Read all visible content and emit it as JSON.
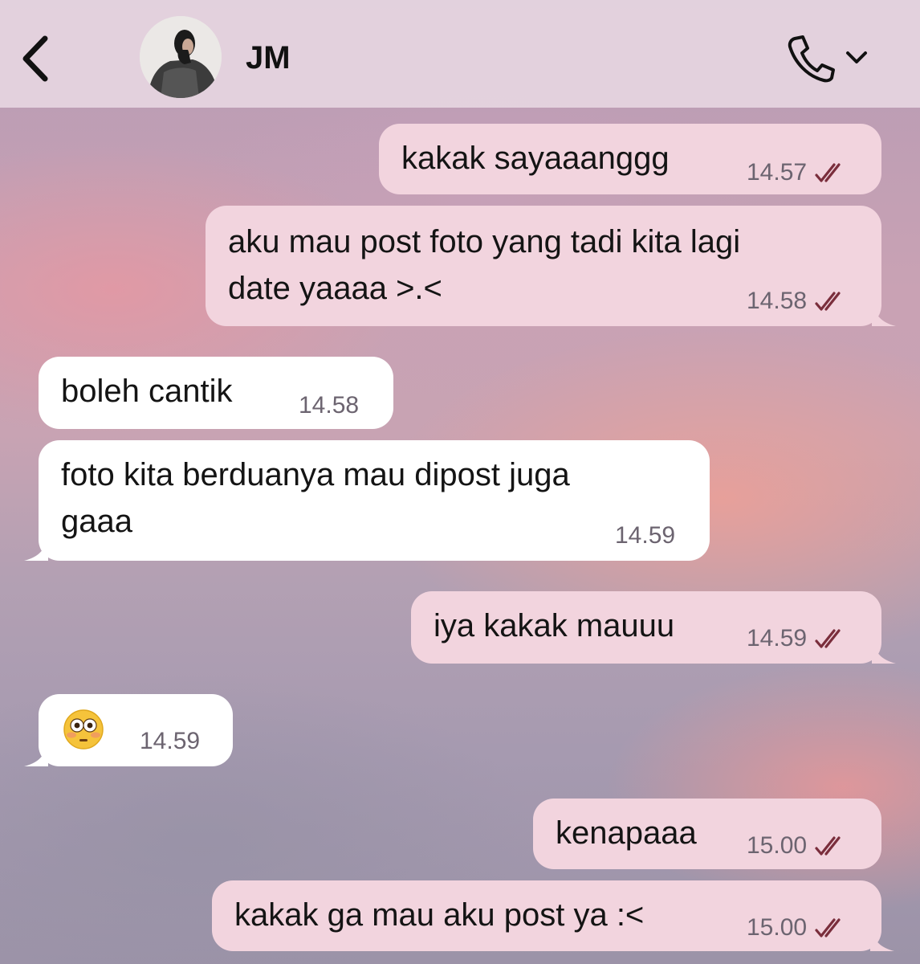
{
  "header": {
    "contact_name": "JM"
  },
  "messages": [
    {
      "direction": "outgoing",
      "text": "kakak sayaaanggg",
      "time": "14.57",
      "read": true
    },
    {
      "direction": "outgoing",
      "text_line1": "aku mau post foto yang tadi kita lagi",
      "text_line2": "date yaaaa >.<",
      "time": "14.58",
      "read": true
    },
    {
      "direction": "incoming",
      "text": "boleh cantik",
      "time": "14.58"
    },
    {
      "direction": "incoming",
      "text_line1": "foto kita berduanya mau dipost juga",
      "text_line2": "gaaa",
      "time": "14.59"
    },
    {
      "direction": "outgoing",
      "text": "iya kakak mauuu",
      "time": "14.59",
      "read": true
    },
    {
      "direction": "incoming",
      "emoji": "flushed-face-emoji",
      "time": "14.59"
    },
    {
      "direction": "outgoing",
      "text": "kenapaaa",
      "time": "15.00",
      "read": true
    },
    {
      "direction": "outgoing",
      "text": "kakak ga mau aku post ya :<",
      "time": "15.00",
      "read": true
    }
  ],
  "colors": {
    "outgoing_bubble": "#f2d4de",
    "incoming_bubble": "#ffffff",
    "read_ticks": "#7a2e3c",
    "header_bg": "#e6d6e1"
  },
  "icons": {
    "back": "chevron-left-icon",
    "call": "phone-icon",
    "call_menu": "chevron-down-icon",
    "read_receipt": "double-check-icon"
  }
}
